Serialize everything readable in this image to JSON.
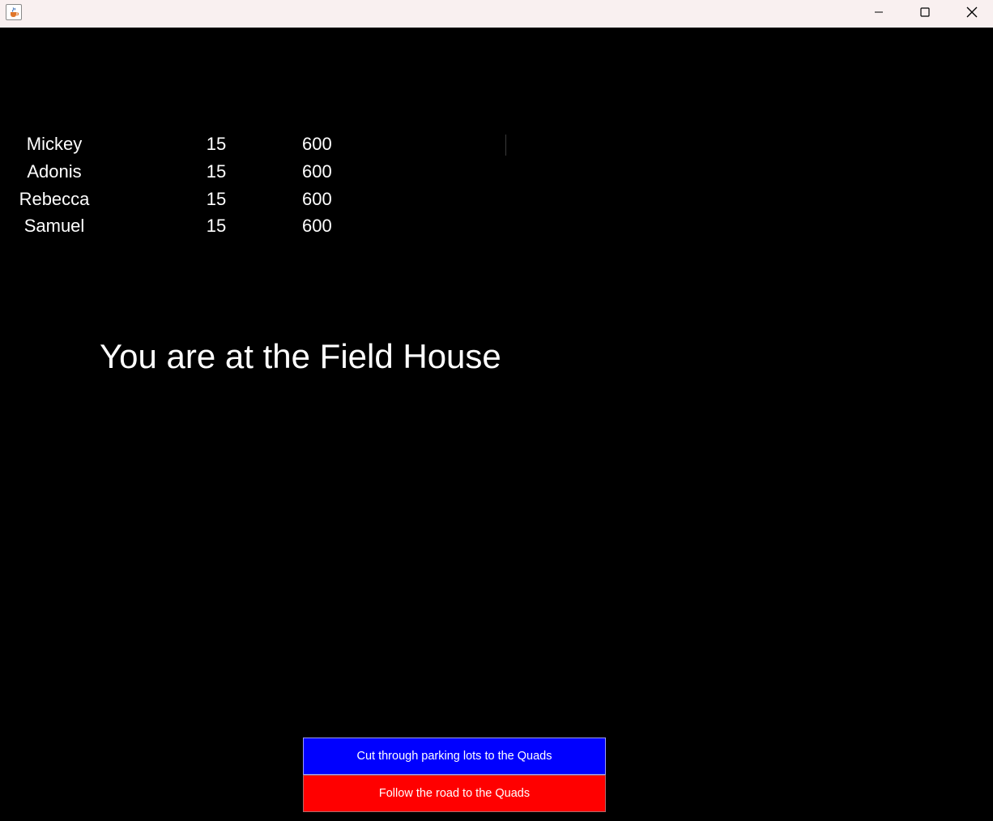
{
  "window": {
    "app_icon": "java-coffee-cup-icon",
    "controls": {
      "minimize_icon": "minimize-icon",
      "maximize_icon": "maximize-icon",
      "close_icon": "close-icon"
    }
  },
  "party": [
    {
      "name": "Mickey",
      "level": "15",
      "money": "600"
    },
    {
      "name": "Adonis",
      "level": "15",
      "money": "600"
    },
    {
      "name": "Rebecca",
      "level": "15",
      "money": "600"
    },
    {
      "name": "Samuel",
      "level": "15",
      "money": "600"
    }
  ],
  "location_text": "You are at the Field House",
  "choices": [
    {
      "label": "Cut through parking lots to the Quads",
      "color": "#0000ff"
    },
    {
      "label": "Follow the road to the Quads",
      "color": "#ff0000"
    }
  ],
  "colors": {
    "background": "#000000",
    "text": "#ffffff",
    "titlebar": "#f9f0f0"
  }
}
